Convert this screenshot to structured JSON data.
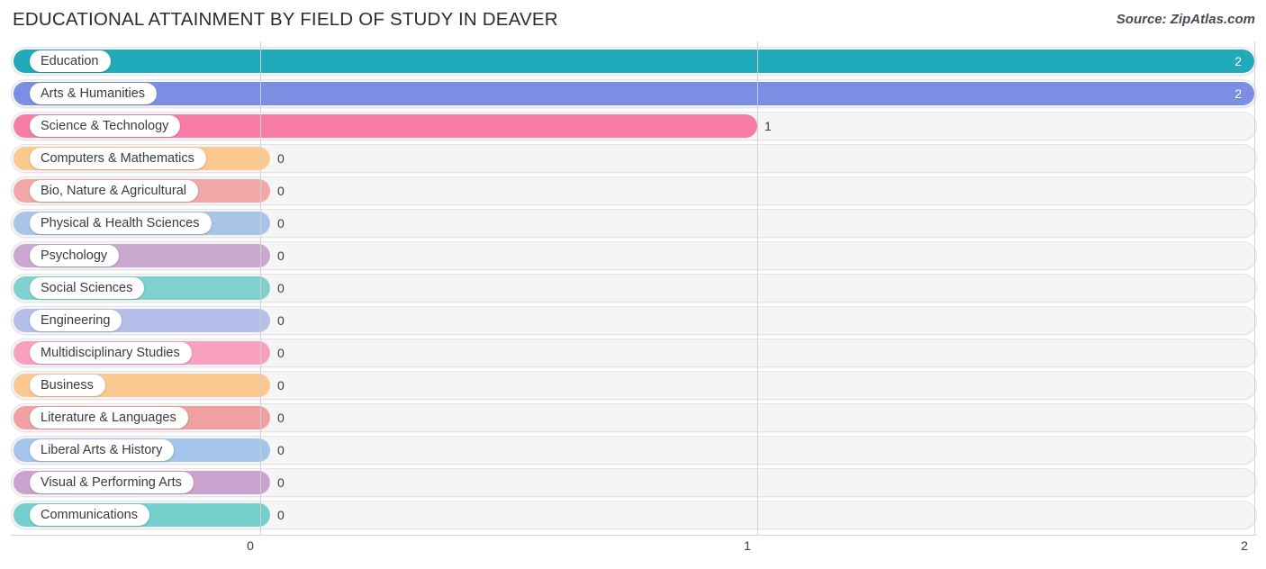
{
  "header": {
    "title": "EDUCATIONAL ATTAINMENT BY FIELD OF STUDY IN DEAVER",
    "source": "Source: ZipAtlas.com"
  },
  "chart_data": {
    "type": "bar",
    "orientation": "horizontal",
    "title": "EDUCATIONAL ATTAINMENT BY FIELD OF STUDY IN DEAVER",
    "xlabel": "",
    "ylabel": "",
    "xlim": [
      0,
      2
    ],
    "xticks": [
      "0",
      "1",
      "2"
    ],
    "grid": true,
    "legend": false,
    "categories": [
      "Education",
      "Arts & Humanities",
      "Science & Technology",
      "Computers & Mathematics",
      "Bio, Nature & Agricultural",
      "Physical & Health Sciences",
      "Psychology",
      "Social Sciences",
      "Engineering",
      "Multidisciplinary Studies",
      "Business",
      "Literature & Languages",
      "Liberal Arts & History",
      "Visual & Performing Arts",
      "Communications"
    ],
    "values": [
      2,
      2,
      1,
      0,
      0,
      0,
      0,
      0,
      0,
      0,
      0,
      0,
      0,
      0,
      0
    ],
    "value_labels": [
      "2",
      "2",
      "1",
      "0",
      "0",
      "0",
      "0",
      "0",
      "0",
      "0",
      "0",
      "0",
      "0",
      "0",
      "0"
    ],
    "colors": [
      "#21aaba",
      "#7c8ee4",
      "#f87ca8",
      "#fbc88e",
      "#f0a8a8",
      "#a8c5e8",
      "#cba8cf",
      "#7fd0ce",
      "#b4bfea",
      "#f7a0bf",
      "#fbc890",
      "#f0a0a0",
      "#a5c4e9",
      "#c9a3cd",
      "#74cfcd"
    ]
  }
}
